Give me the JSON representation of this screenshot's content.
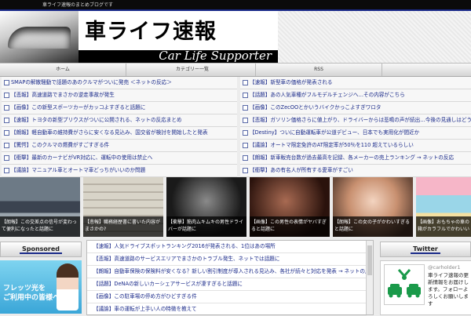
{
  "topbar": {
    "text": "車ライフ速報のまとめブログです"
  },
  "header": {
    "title_jp": "車ライフ速報",
    "title_en": "Car Life Supporter"
  },
  "nav": {
    "tabs": [
      "ホーム",
      "カテゴリー一覧",
      "RSS"
    ]
  },
  "headlines_left": [
    "SMAPの解散騒動で話題のあのクルマがついに発売 ＜ネットの反応＞",
    "【悲報】高速道路でまさかの逆走事故が発生",
    "【画像】この新型スポーツカーがカッコよすぎると話題に",
    "【速報】トヨタの新型プリウスがついに公開される、ネットの反応まとめ",
    "【朗報】軽自動車の維持費がさらに安くなる見込み、国交省が検討を開始したと発表",
    "【驚愕】このクルマの燃費がすごすぎる件",
    "【衝撃】最新のカーナビがVR対応に、運転中の使用は禁止へ",
    "【議論】マニュアル車とオートマ車どっちがいいのか問題"
  ],
  "headlines_right": [
    "【速報】新型車の価格が発表される",
    "【話題】あの人気車種がフルモデルチェンジへ…その内容がこちら",
    "【画像】このZecOOとかいうバイクかっこよすぎワロタ",
    "【悲報】ガソリン価格さらに値上がり、ドライバーからは悲鳴の声が続出…今後の見通しはどうなる",
    "【Destiny】ついに自動運転車が公道デビュー、日本でも実用化が間近か",
    "【議論】オートマ限定免許のAT限定率が50％を110 超えているらしい",
    "【朗報】新車販売台数が過去最高を記録、各メーカーの売上ランキング → ネットの反応",
    "【衝撃】あの有名人が所有する愛車がすごい"
  ],
  "thumbnails": [
    {
      "caption": "【朗報】この交差点の信号が変わって便利になったと話題に"
    },
    {
      "caption": "【悲報】職務経歴書に書いた内容がまさかの?"
    },
    {
      "caption": "【衝撃】筋肉ムキムキの男性ドライバーが話題に"
    },
    {
      "caption": "【画像】この男性の表情がヤバすぎると話題に"
    },
    {
      "caption": "【朗報】この女の子がかわいすぎると話題に"
    },
    {
      "caption": "【画像】おもちゃの車の箱がカラフルでかわいい"
    }
  ],
  "sponsored": {
    "title": "Sponsored",
    "ad_line1": "フレッツ光を",
    "ad_line2": "ご利用中の皆様へ"
  },
  "center_links": [
    "【速報】人気ドライブスポットランキング2016が発表される、1位はあの場所",
    "【悲報】高速道路のサービスエリアでまさかのトラブル発生、ネットでは話題に",
    "【朗報】自動車保険の保険料が安くなる？新しい割引制度が導入される見込み、各社が続々と対応を発表 → ネットの反応",
    "【話題】DeNAの新しいカーシェアサービスが凄すぎると話題に",
    "【画像】この駐車場の停め方がひどすぎる件",
    "【議論】車の運転が上手い人の特徴を教えて"
  ],
  "twitter": {
    "title": "Twitter",
    "handle": "@carholder1",
    "text": "車ライフ速報の更新情報をお届けします。フォローよろしくお願いします"
  }
}
